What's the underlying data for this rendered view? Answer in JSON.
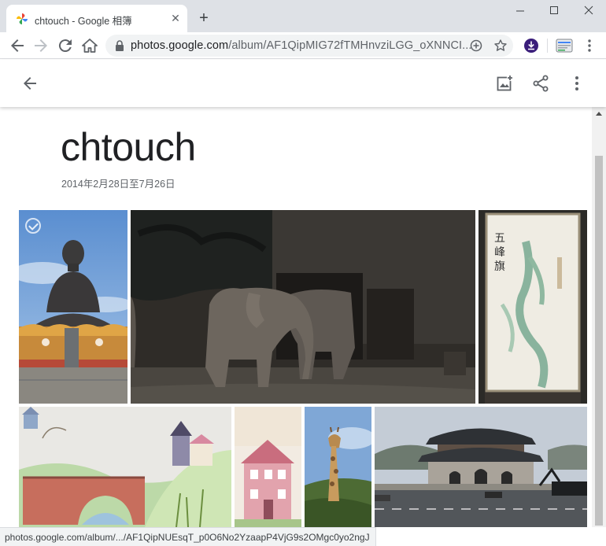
{
  "browser": {
    "tab_title": "chtouch - Google 相簿",
    "url_host": "photos.google.com",
    "url_path": "/album/AF1QipMIG72fTMHnvziLGG_oXNNCI...",
    "status_url": "photos.google.com/album/.../AF1QipNUEsqT_p0O6No2YzaapP4VjG9s2OMgc0yo2ngJ"
  },
  "album": {
    "title": "chtouch",
    "date_range": "2014年2月28日至7月26日"
  },
  "photos": [
    {
      "subject": "buddha-statue",
      "selected": true
    },
    {
      "subject": "elephants"
    },
    {
      "subject": "mountain-map"
    },
    {
      "subject": "bridge-drawing"
    },
    {
      "subject": "pink-house-drawing"
    },
    {
      "subject": "giraffe"
    },
    {
      "subject": "palace-gate"
    }
  ],
  "colors": {
    "chrome_bg": "#dee1e6",
    "text_primary": "#202124",
    "text_secondary": "#5f6368"
  }
}
